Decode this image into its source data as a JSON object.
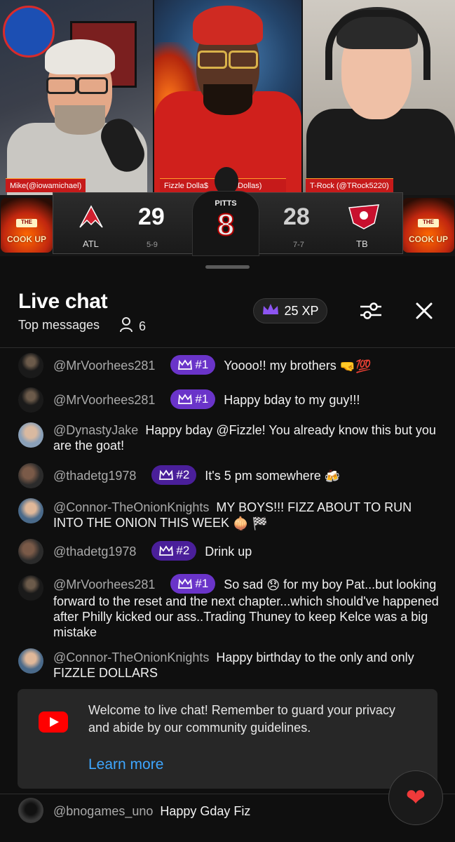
{
  "video": {
    "hosts": [
      {
        "tag": "Mike(@iowamichael)"
      },
      {
        "tag": "Fizzle Dolla$"
      },
      {
        "tag": "T-Rock (@TRock5220)"
      }
    ],
    "tag_suffix_2": "leDollas)",
    "show_logo": "THE COOK UP",
    "scoreboard": {
      "home": {
        "abbr": "ATL",
        "score": "29",
        "record": "5-9"
      },
      "away": {
        "abbr": "TB",
        "score": "28",
        "record": "7-7"
      },
      "player_name": "PITTS",
      "player_number": "8"
    }
  },
  "chat": {
    "title": "Live chat",
    "mode": "Top messages",
    "viewer_count": "6",
    "xp": "25 XP",
    "messages": [
      {
        "author": "@MrVoorhees281",
        "badge": "#1",
        "text": "Yoooo!! my brothers",
        "emoji": "🤜💯"
      },
      {
        "author": "@MrVoorhees281",
        "badge": "#1",
        "text": "Happy bday to my guy!!!"
      },
      {
        "author": "@DynastyJake",
        "text": "Happy bday @Fizzle! You already know this but you are the goat!"
      },
      {
        "author": "@thadetg1978",
        "badge": "#2",
        "text": "It's 5 pm somewhere",
        "emoji": "🍻"
      },
      {
        "author": "@Connor-TheOnionKnights",
        "text": "MY BOYS!!! FIZZ ABOUT TO RUN INTO THE ONION THIS WEEK",
        "emoji": "🧅 🏁"
      },
      {
        "author": "@thadetg1978",
        "badge": "#2",
        "text": "Drink up"
      },
      {
        "author": "@MrVoorhees281",
        "badge": "#1",
        "text_a": "So sad",
        "emoji": "😞",
        "text_b": "for my boy Pat...but looking forward to the reset and the next chapter...which should've happened after Philly kicked our ass..Trading Thuney to keep Kelce was a big mistake"
      },
      {
        "author": "@Connor-TheOnionKnights",
        "text": "Happy birthday to the only and only FIZZLE DOLLARS"
      }
    ],
    "welcome": {
      "text": "Welcome to live chat! Remember to guard your privacy and abide by our community guidelines.",
      "link": "Learn more"
    },
    "last_message": {
      "author": "@bnogames_uno",
      "text": "Happy Gday Fiz"
    },
    "heart_icon": "heart-icon"
  }
}
